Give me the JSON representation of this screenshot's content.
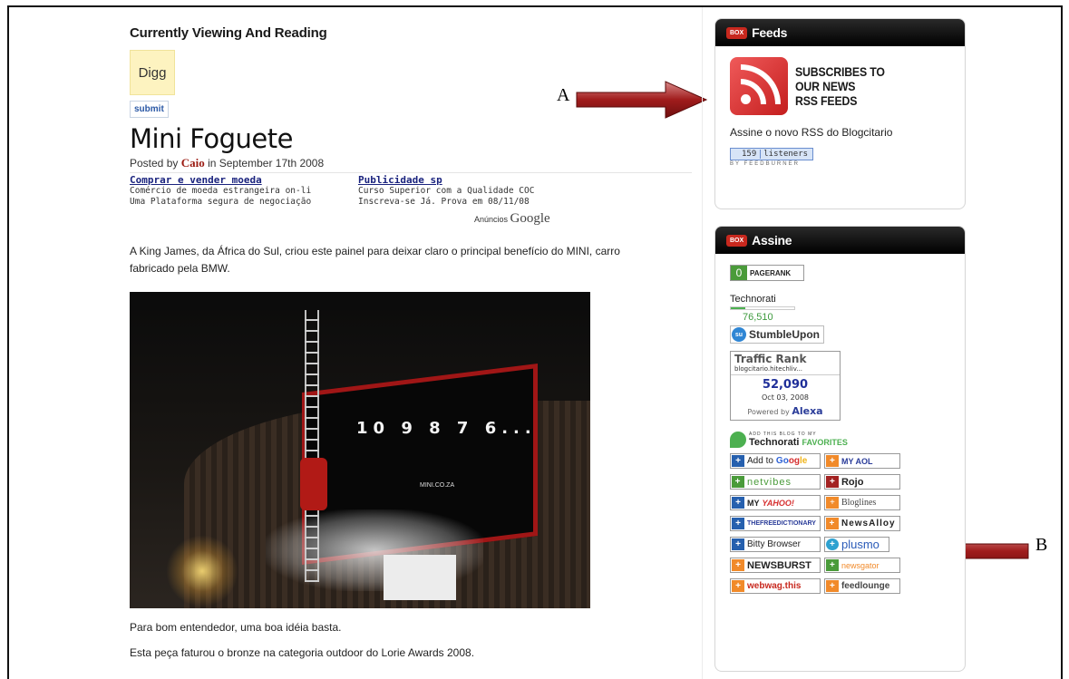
{
  "post": {
    "section_heading": "Currently Viewing And Reading",
    "digg_label": "Digg",
    "submit_label": "submit",
    "title": "Mini Foguete",
    "posted_prefix": "Posted by",
    "author": "Caio",
    "posted_suffix": "in September 17th 2008",
    "paragraph": "A King James, da África do Sul, criou este painel para deixar claro o principal benefício do MINI, carro fabricado pela BMW.",
    "countdown": "10  9  8  7  6...",
    "photo_brand": "MINI.CO.ZA",
    "caption": "Para bom entendedor, uma boa idéia basta.",
    "caption2": "Esta peça faturou o bronze na categoria outdoor do Lorie Awards 2008."
  },
  "ads": {
    "items": [
      {
        "title": "Comprar e vender moeda",
        "line1": "Comércio de moeda estrangeira on-li",
        "line2": "Uma Plataforma segura de negociação"
      },
      {
        "title": "Publicidade sp",
        "line1": "Curso Superior com a Qualidade COC",
        "line2": "Inscreva-se Já. Prova em 08/11/08"
      }
    ],
    "footer_prefix": "Anúncios",
    "footer_brand": "Google"
  },
  "annotations": {
    "a": "A",
    "b": "B"
  },
  "feeds": {
    "badge": "BOX",
    "title": "Feeds",
    "rss_line1": "SUBSCRIBES TO",
    "rss_line2": "OUR NEWS",
    "rss_line3": "RSS FEEDS",
    "assine_text": "Assine o novo RSS do Blogcitario",
    "counter_value": "159",
    "counter_label": "listeners",
    "counter_by": "BY FEEDBURNER"
  },
  "assine": {
    "badge": "BOX",
    "title": "Assine",
    "pagerank_value": "0",
    "pagerank_label": "PAGERANK",
    "technorati_label": "Technorati",
    "technorati_value": "76,510",
    "stumble_label": "StumbleUpon",
    "stumble_icon_text": "su",
    "alexa_title": "Traffic Rank",
    "alexa_site": "blogcitario.hitechliv...",
    "alexa_rank": "52,090",
    "alexa_date": "Oct 03, 2008",
    "alexa_powered": "Powered by",
    "alexa_brand": "Alexa",
    "techfav_small": "ADD THIS BLOG TO MY",
    "techfav_big": "Technorati",
    "techfav_accent": "FAVORITES",
    "buttons": {
      "google_prefix": "Add to",
      "google_g1": "Go",
      "google_g2": "og",
      "google_g3": "le",
      "myaol": "MY AOL",
      "netvibes": "netvibes",
      "rojo": "Rojo",
      "yahoo_prefix": "MY",
      "yahoo_brand": "YAHOO!",
      "bloglines": "Bloglines",
      "freedictionary": "THEFREEDICTIONARY",
      "newsalloy": "NewsAlloy",
      "bitty": "Bitty Browser",
      "plusmo": "plusmo",
      "newsburst": "NEWSBURST",
      "newsgator": "newsgator",
      "webwag": "webwag.this",
      "feedlounge": "feedlounge"
    }
  }
}
